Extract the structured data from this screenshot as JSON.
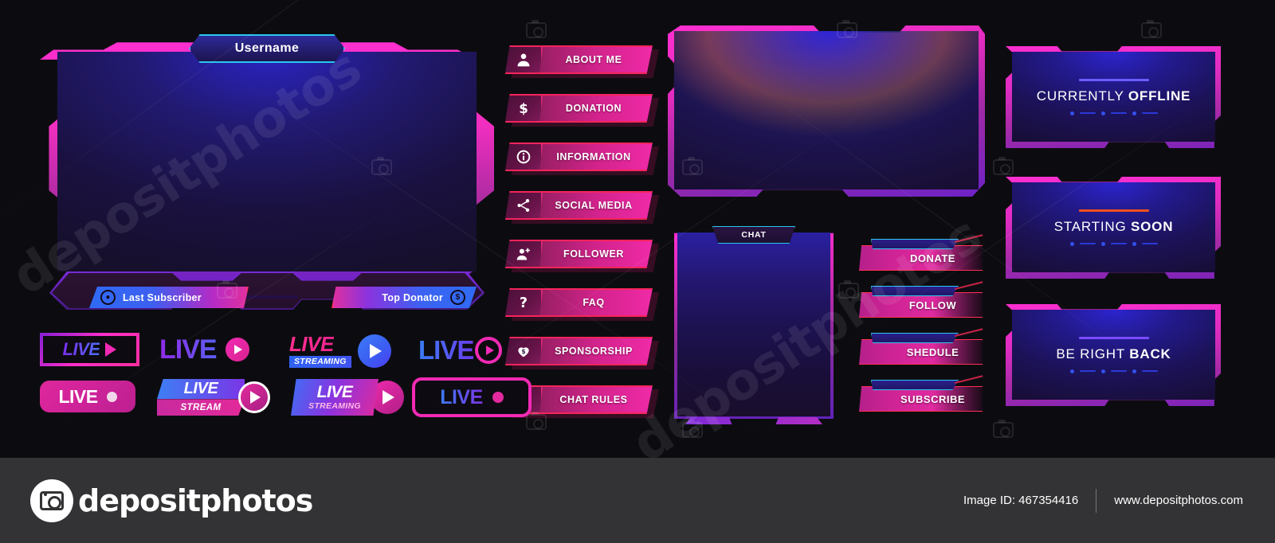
{
  "facecam": {
    "username": "Username",
    "last_subscriber": "Last Subscriber",
    "top_donator": "Top Donator",
    "sub_icon": "user-icon",
    "donator_icon": "dollar-icon"
  },
  "menu": {
    "items": [
      {
        "label": "ABOUT ME",
        "icon": "person-icon"
      },
      {
        "label": "DONATION",
        "icon": "dollar-sign-icon"
      },
      {
        "label": "INFORMATION",
        "icon": "info-circle-icon"
      },
      {
        "label": "SOCIAL MEDIA",
        "icon": "share-icon"
      },
      {
        "label": "FOLLOWER",
        "icon": "person-plus-icon"
      },
      {
        "label": "FAQ",
        "icon": "question-mark-icon"
      },
      {
        "label": "SPONSORSHIP",
        "icon": "heart-dollar-icon"
      },
      {
        "label": "CHAT RULES",
        "icon": "exclamation-chat-icon"
      }
    ]
  },
  "chat": {
    "tab_label": "CHAT"
  },
  "actions": {
    "items": [
      {
        "label": "DONATE"
      },
      {
        "label": "FOLLOW"
      },
      {
        "label": "SHEDULE"
      },
      {
        "label": "SUBSCRIBE"
      }
    ]
  },
  "status_screens": [
    {
      "light": "CURRENTLY",
      "bold": "OFFLINE",
      "accent": "#6b5cff"
    },
    {
      "light": "STARTING",
      "bold": "SOON",
      "accent": "#f0501e"
    },
    {
      "light": "BE RIGHT",
      "bold": "BACK",
      "accent": "#7a4cff"
    }
  ],
  "live_badges": [
    {
      "id": "live-outline-triangle",
      "text": "LIVE",
      "sub": "",
      "icon": "play-triangle-icon"
    },
    {
      "id": "live-circle-play",
      "text": "LIVE",
      "sub": "",
      "icon": "play-circle-icon"
    },
    {
      "id": "live-streaming-blue-play",
      "text": "LIVE",
      "sub": "STREAMING",
      "icon": "play-circle-icon"
    },
    {
      "id": "live-ring-play",
      "text": "LIVE",
      "sub": "",
      "icon": "play-ring-icon"
    },
    {
      "id": "live-solid-dot",
      "text": "LIVE",
      "sub": "",
      "icon": "record-dot-icon"
    },
    {
      "id": "live-stream-ring-play",
      "text": "LIVE",
      "sub": "STREAM",
      "icon": "play-circle-icon"
    },
    {
      "id": "live-streaming-play",
      "text": "LIVE",
      "sub": "STREAMING",
      "icon": "play-circle-icon"
    },
    {
      "id": "live-outline-dot",
      "text": "LIVE",
      "sub": "",
      "icon": "record-dot-icon"
    }
  ],
  "footer": {
    "brand": "depositphotos",
    "image_id": "Image ID: 467354416",
    "website": "www.depositphotos.com"
  },
  "colors": {
    "pink": "#ff2fd0",
    "magenta": "#e02aa0",
    "cyan": "#28c8ef",
    "blue": "#3d7bf5",
    "purple": "#7b2ff0",
    "red_edge": "#ff2f55",
    "background": "#0c0c10",
    "footer_bg": "#333335"
  }
}
